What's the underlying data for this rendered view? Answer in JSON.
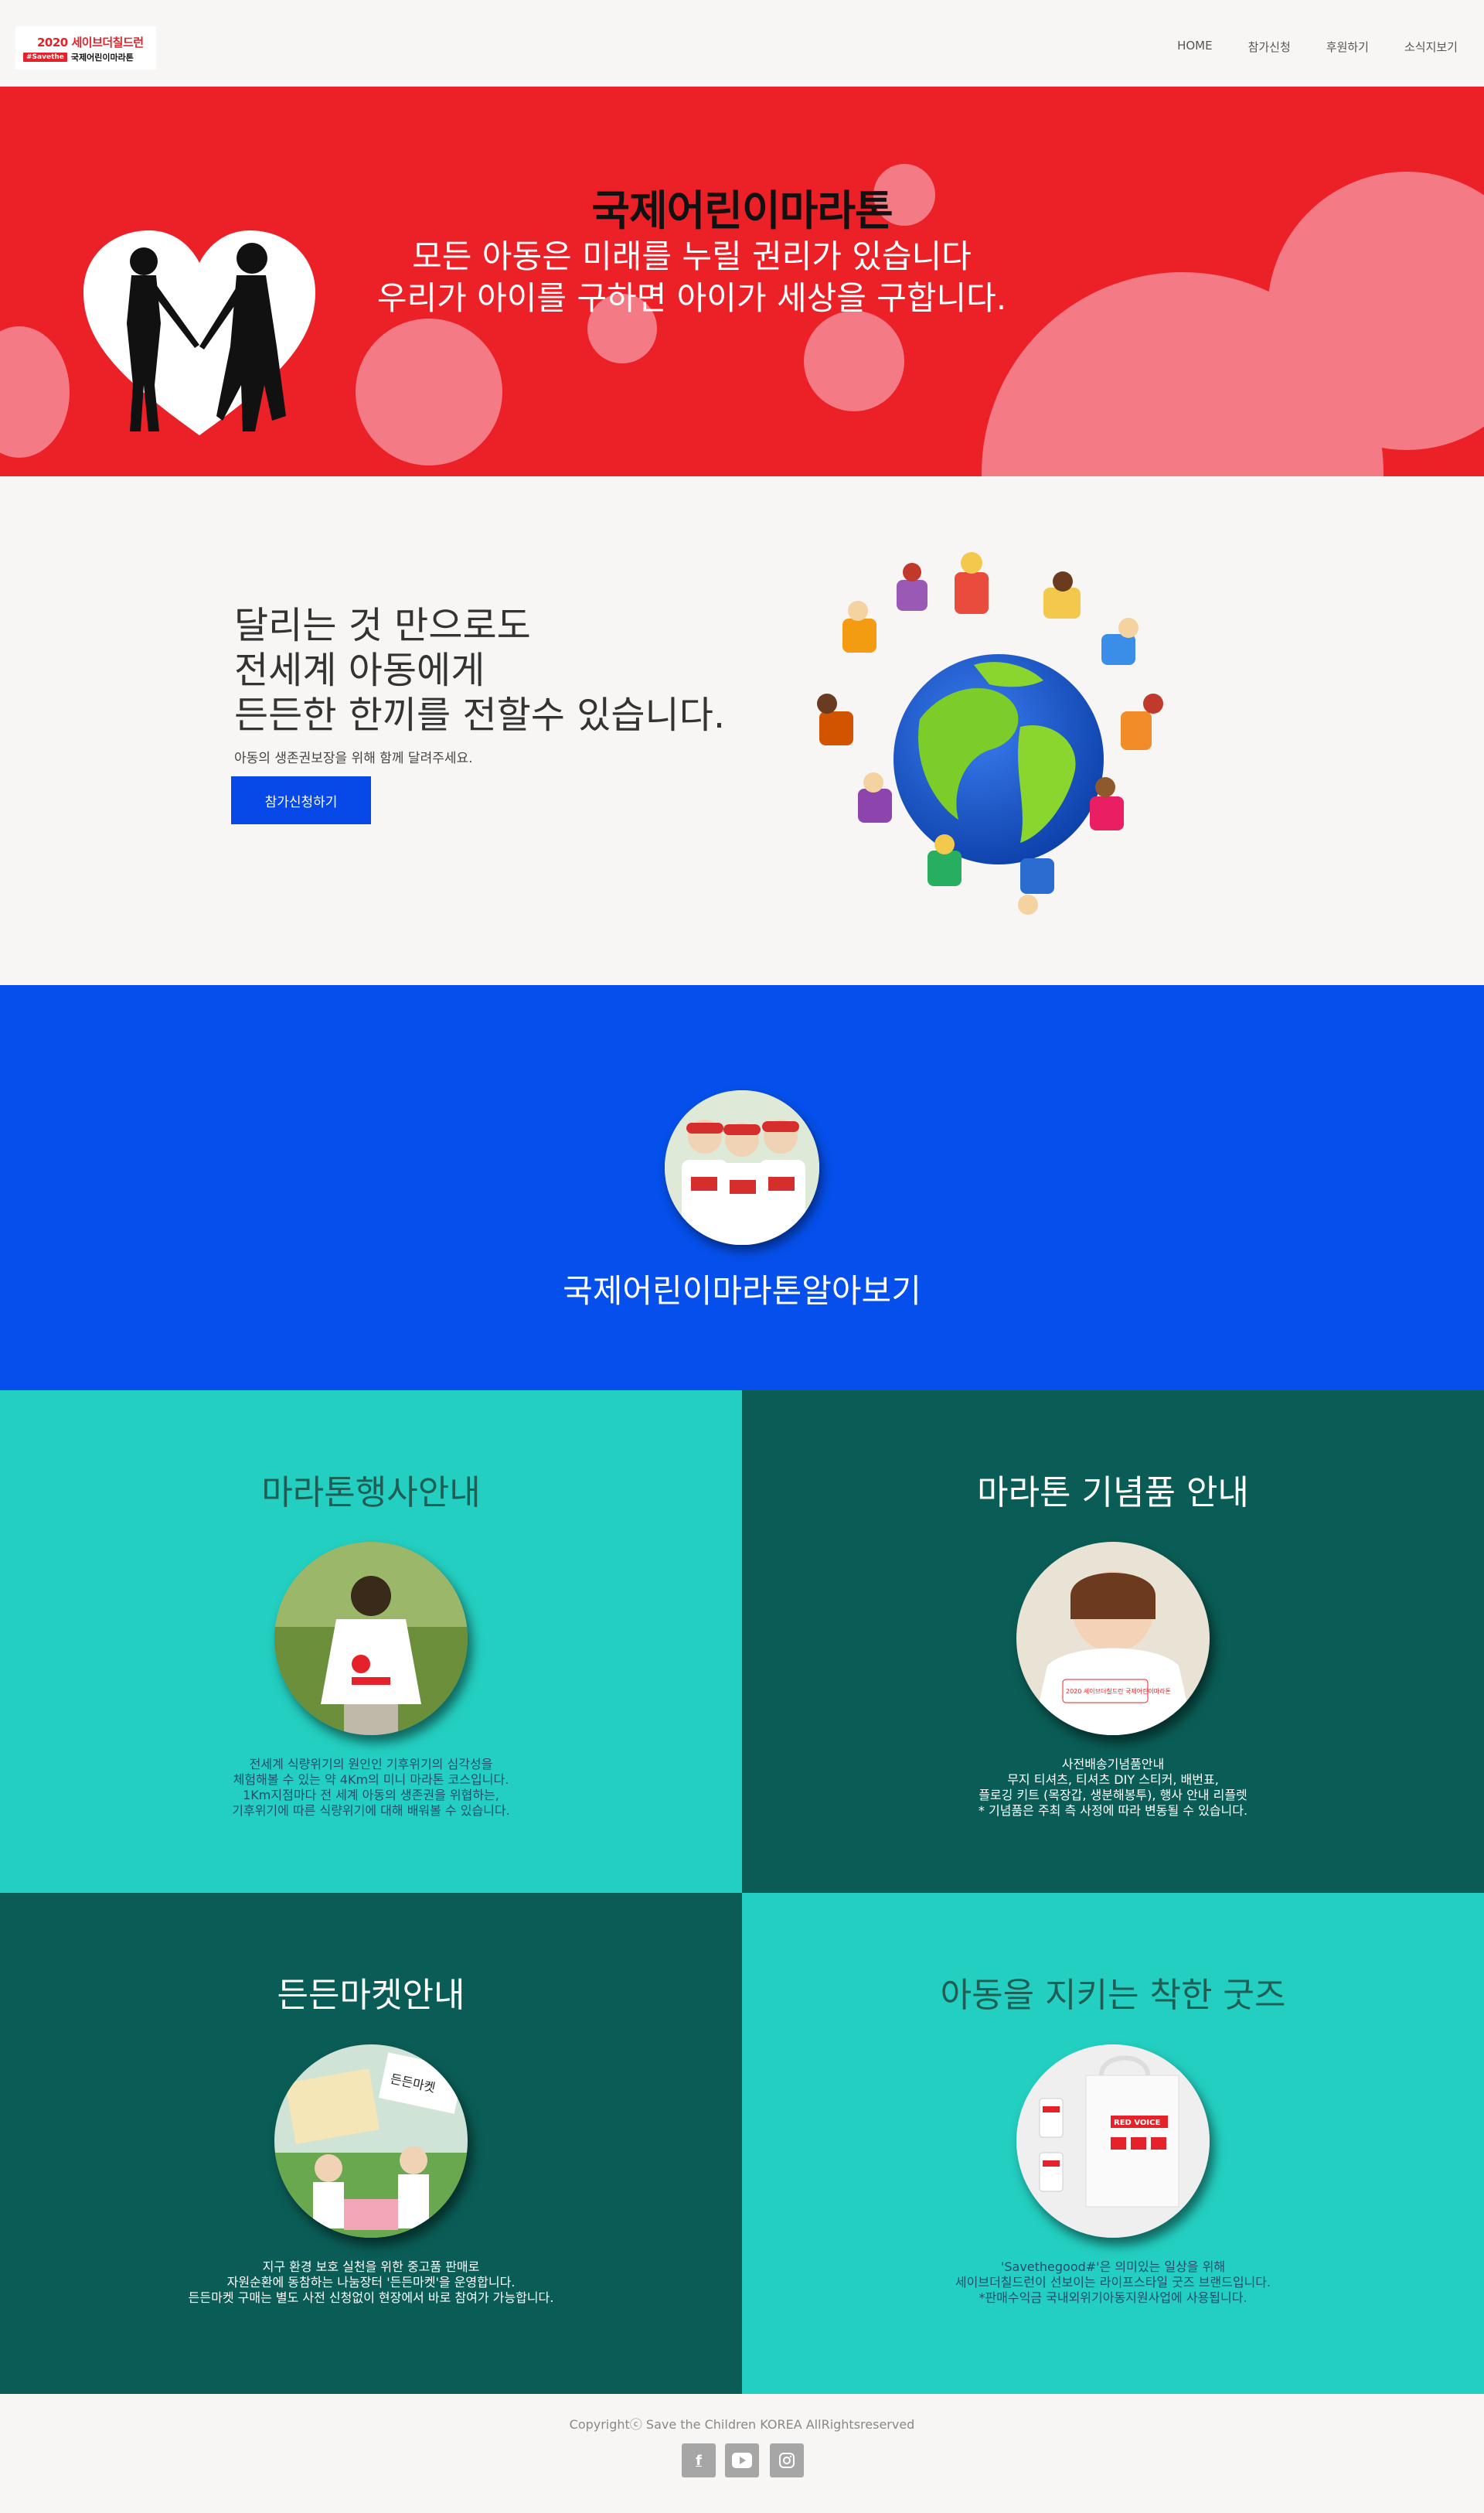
{
  "header": {
    "logo_line1": "2020 세이브더칠드런",
    "logo_tag": "#Savethe",
    "logo_line2": "국제어린이마라톤",
    "nav": [
      "HOME",
      "참가신청",
      "후원하기",
      "소식지보기"
    ]
  },
  "hero": {
    "title": "국제어린이마라톤",
    "subtitle1": "모든 아동은 미래를 누릴 권리가 있습니다",
    "subtitle2": "우리가 아이를 구하면 아이가 세상을 구합니다."
  },
  "intro": {
    "heading_lines": [
      "달리는 것 만으로도",
      "전세계 아동에게",
      "든든한 한끼를 전할수 있습니다."
    ],
    "description": "아동의 생존권보장을 위해 함께 달려주세요.",
    "button_label": "참가신청하기"
  },
  "about": {
    "title": "국제어린이마라톤알아보기"
  },
  "sections": [
    {
      "title": "마라톤행사안내",
      "lines": [
        "전세계 식량위기의 원인인 기후위기의 심각성을",
        "체험해볼 수 있는 약 4Km의 미니 마라톤 코스입니다.",
        "1Km지점마다 전 세계 아동의 생존권을 위협하는,",
        "기후위기에 따른 식량위기에 대해 배워볼 수 있습니다."
      ]
    },
    {
      "title": "마라톤 기념품 안내",
      "photo_caption": "2020 세이브더칠드런 국제어린이마라톤",
      "lines": [
        "사전배송기념품안내",
        "무지 티셔츠, 티셔츠 DIY 스티커, 배번표,",
        "플로깅 키트 (목장갑, 생분해봉투), 행사 안내 리플렛",
        "* 기념품은 주최 측 사정에 따라 변동될 수 있습니다."
      ]
    },
    {
      "title": "든든마켓안내",
      "photo_caption": "든든마켓",
      "lines": [
        "지구 환경 보호 실천을 위한 중고품 판매로",
        "자원순환에 동참하는 나눔장터 '든든마켓'을 운영합니다.",
        "든든마켓 구매는 별도 사전 신청없이 현장에서 바로 참여가 가능합니다."
      ]
    },
    {
      "title": "아동을 지키는 착한 굿즈",
      "photo_caption": "RED VOICE",
      "lines": [
        "'Savethegood#'은 의미있는 일상을 위해",
        "세이브더칠드런이 선보이는 라이프스타일 굿즈 브랜드입니다.",
        "*판매수익금 국내외위기아동지원사업에 사용됩니다."
      ]
    }
  ],
  "footer": {
    "copyright": "Copyrightⓒ   Save the Children KOREA  AllRightsreserved",
    "social": [
      "facebook-icon",
      "youtube-icon",
      "instagram-icon"
    ]
  },
  "colors": {
    "hero_red": "#ec2128",
    "hero_heart": "#f47a86",
    "button_blue": "#0648e8",
    "section_blue": "#0550ec",
    "teal": "#23cfc1",
    "dark_teal": "#0a5d56"
  }
}
